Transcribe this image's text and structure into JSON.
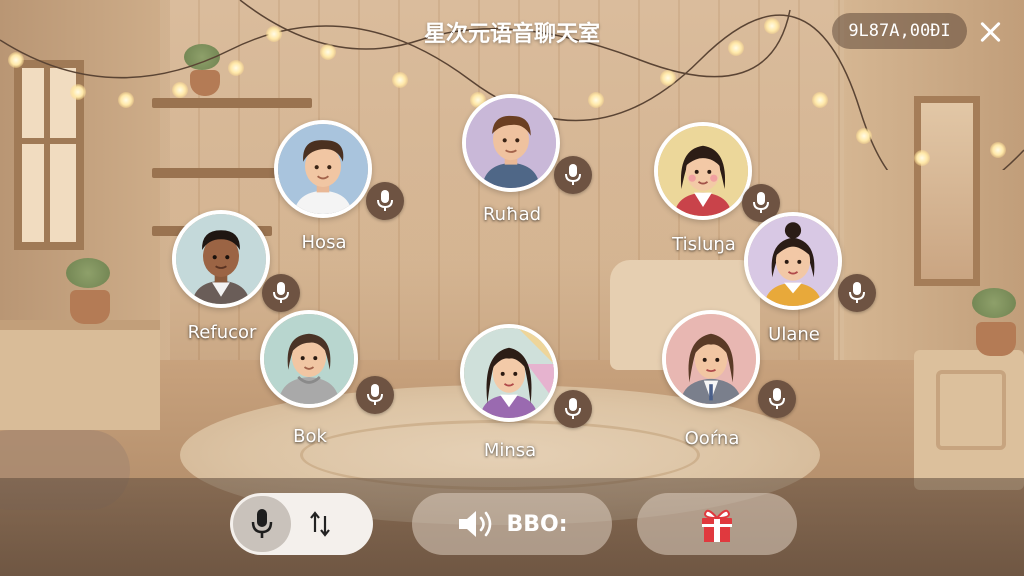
{
  "header": {
    "title": "星次元语音聊天室",
    "room_id": "9L87A,00ĐI",
    "close_icon": "close-icon"
  },
  "seats": [
    {
      "name": "Ruħad",
      "avatar": "avatar-man-beige",
      "bg": "#c9b8d8",
      "mic": "microphone-icon"
    },
    {
      "name": "Hosa",
      "avatar": "avatar-boy-blue",
      "bg": "#a9c4dd",
      "mic": "microphone-icon"
    },
    {
      "name": "Tisluŋa",
      "avatar": "avatar-girl-yellow",
      "bg": "#ecd79a",
      "mic": "microphone-icon"
    },
    {
      "name": "Refucor",
      "avatar": "avatar-man-dark",
      "bg": "#c4d9da",
      "mic": "microphone-icon"
    },
    {
      "name": "Ulane",
      "avatar": "avatar-girl-bun",
      "bg": "#d8c8e4",
      "mic": "microphone-icon"
    },
    {
      "name": "Bok",
      "avatar": "avatar-boy-hoodie",
      "bg": "#b8d6cf",
      "mic": "microphone-icon"
    },
    {
      "name": "Minsa",
      "avatar": "avatar-girl-longhair",
      "bg": "#cfe0da",
      "mic": "microphone-icon"
    },
    {
      "name": "Ooŕna",
      "avatar": "avatar-woman-pink",
      "bg": "#e8b7b2",
      "mic": "microphone-icon"
    }
  ],
  "bottom_bar": {
    "mic_toggle_icon": "microphone-icon",
    "switch_icon": "switch-arrows-icon",
    "speaker_icon": "speaker-icon",
    "speaker_label": "BBO:",
    "gift_icon": "gift-icon"
  },
  "colors": {
    "badge": "#6e5342",
    "gift_red": "#e0393e",
    "text": "#ffffff"
  }
}
